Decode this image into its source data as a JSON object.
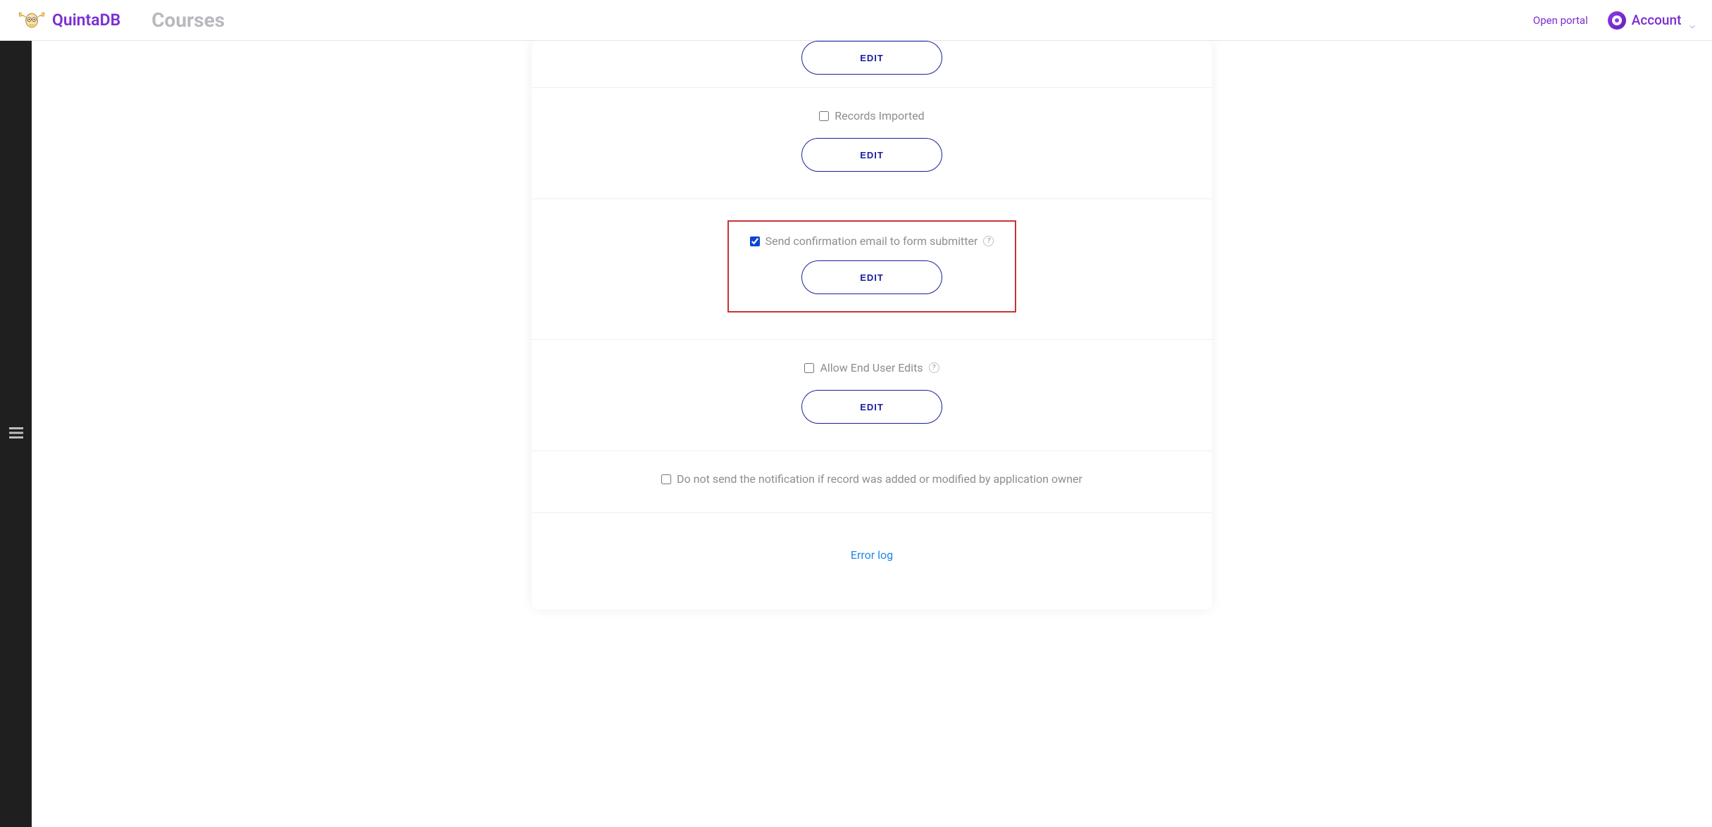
{
  "header": {
    "brand": "QuintaDB",
    "page_title": "Courses",
    "open_portal": "Open portal",
    "account_label": "Account"
  },
  "sections": {
    "top_partial": {
      "edit_label": "EDIT"
    },
    "records_imported": {
      "label": "Records Imported",
      "checked": false,
      "edit_label": "EDIT"
    },
    "confirmation": {
      "label": "Send confirmation email to form submitter",
      "checked": true,
      "help": "?",
      "edit_label": "EDIT"
    },
    "end_user_edits": {
      "label": "Allow End User Edits",
      "checked": false,
      "help": "?",
      "edit_label": "EDIT"
    },
    "no_notification": {
      "label": "Do not send the notification if record was added or modified by application owner",
      "checked": false
    },
    "error_log": "Error log"
  }
}
